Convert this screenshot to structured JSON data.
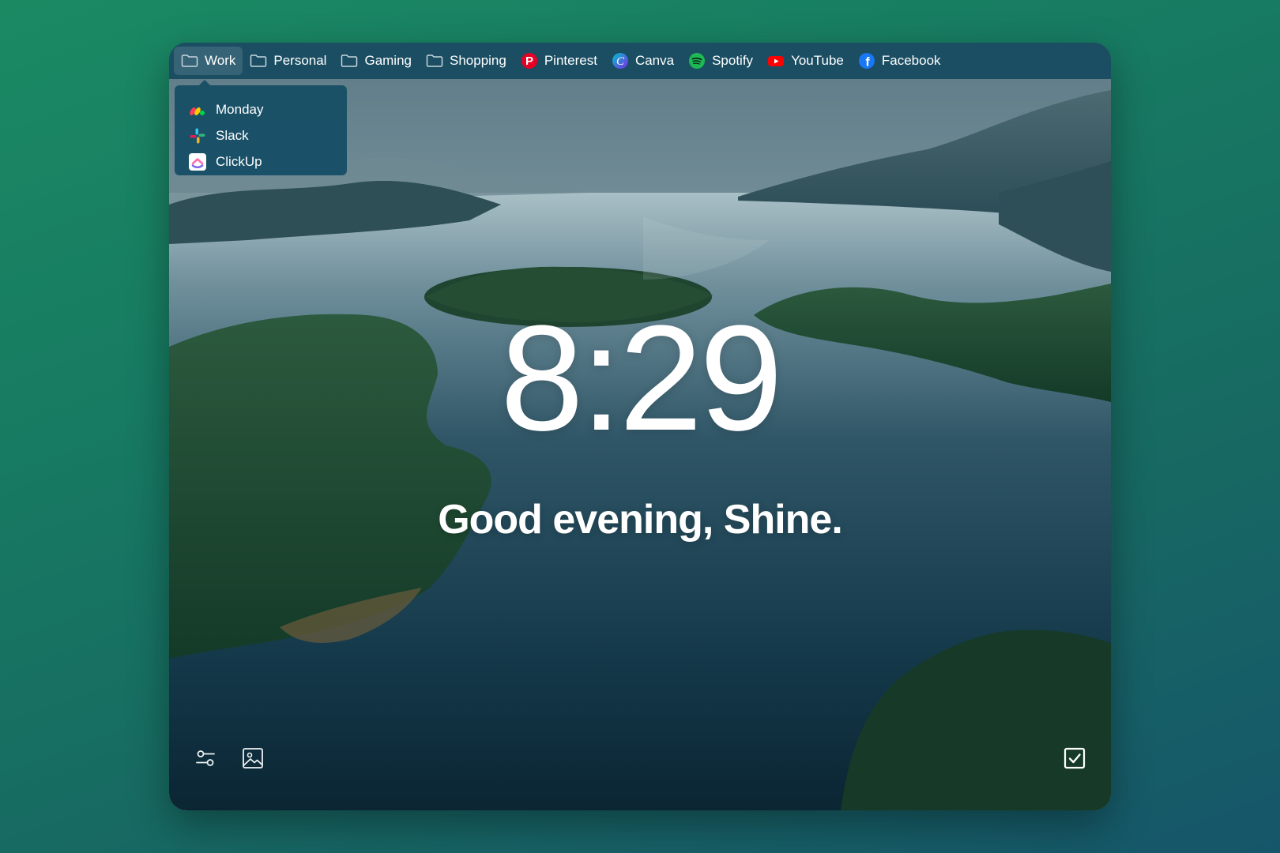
{
  "bookmarks": [
    {
      "label": "Work",
      "icon": "folder-icon",
      "active": true
    },
    {
      "label": "Personal",
      "icon": "folder-icon"
    },
    {
      "label": "Gaming",
      "icon": "folder-icon"
    },
    {
      "label": "Shopping",
      "icon": "folder-icon"
    },
    {
      "label": "Pinterest",
      "icon": "pinterest-icon",
      "color": "#e60023"
    },
    {
      "label": "Canva",
      "icon": "canva-icon",
      "color": "#7d2ae8"
    },
    {
      "label": "Spotify",
      "icon": "spotify-icon",
      "color": "#1db954"
    },
    {
      "label": "YouTube",
      "icon": "youtube-icon",
      "color": "#ff0000"
    },
    {
      "label": "Facebook",
      "icon": "facebook-icon",
      "color": "#1877f2"
    }
  ],
  "dropdown": {
    "items": [
      {
        "label": "Monday",
        "icon": "monday-icon"
      },
      {
        "label": "Slack",
        "icon": "slack-icon"
      },
      {
        "label": "ClickUp",
        "icon": "clickup-icon"
      }
    ]
  },
  "clock": {
    "time": "8:29"
  },
  "greeting": {
    "text": "Good evening, Shine."
  },
  "controls": {
    "settings_icon": "sliders-icon",
    "background_icon": "image-icon",
    "todo_icon": "checkbox-icon"
  }
}
